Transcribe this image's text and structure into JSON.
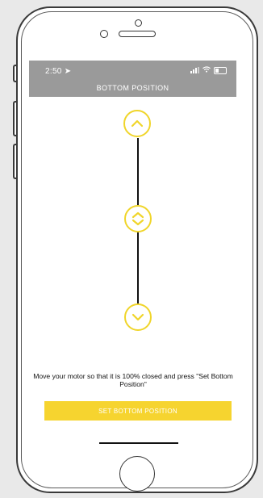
{
  "status": {
    "time": "2:50",
    "location_icon": "location-arrow-icon",
    "signal_icon": "cellular-signal-icon",
    "wifi_icon": "wifi-icon",
    "battery_icon": "battery-icon"
  },
  "header": {
    "title": "BOTTOM POSITION"
  },
  "controls": {
    "up_icon": "chevron-up-icon",
    "step_icon": "chevron-up-down-icon",
    "down_icon": "chevron-down-icon"
  },
  "instructions": "Move your motor so that it is 100% closed and press \"Set Bottom Position\"",
  "set_button_label": "SET BOTTOM POSITION",
  "colors": {
    "accent": "#f6d42f",
    "header_bg": "#9a9a9a",
    "ring": "#f0d52a"
  }
}
